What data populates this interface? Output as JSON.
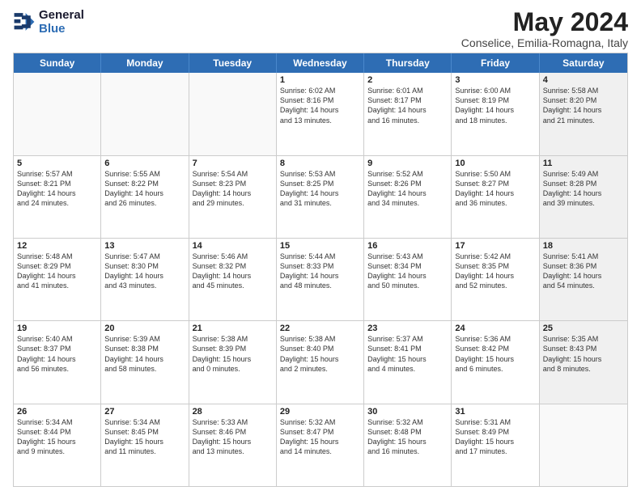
{
  "logo": {
    "line1": "General",
    "line2": "Blue"
  },
  "title": "May 2024",
  "subtitle": "Conselice, Emilia-Romagna, Italy",
  "calendar": {
    "headers": [
      "Sunday",
      "Monday",
      "Tuesday",
      "Wednesday",
      "Thursday",
      "Friday",
      "Saturday"
    ],
    "rows": [
      [
        {
          "day": "",
          "detail": "",
          "empty": true
        },
        {
          "day": "",
          "detail": "",
          "empty": true
        },
        {
          "day": "",
          "detail": "",
          "empty": true
        },
        {
          "day": "1",
          "detail": "Sunrise: 6:02 AM\nSunset: 8:16 PM\nDaylight: 14 hours\nand 13 minutes.",
          "empty": false
        },
        {
          "day": "2",
          "detail": "Sunrise: 6:01 AM\nSunset: 8:17 PM\nDaylight: 14 hours\nand 16 minutes.",
          "empty": false
        },
        {
          "day": "3",
          "detail": "Sunrise: 6:00 AM\nSunset: 8:19 PM\nDaylight: 14 hours\nand 18 minutes.",
          "empty": false
        },
        {
          "day": "4",
          "detail": "Sunrise: 5:58 AM\nSunset: 8:20 PM\nDaylight: 14 hours\nand 21 minutes.",
          "empty": false,
          "shaded": true
        }
      ],
      [
        {
          "day": "5",
          "detail": "Sunrise: 5:57 AM\nSunset: 8:21 PM\nDaylight: 14 hours\nand 24 minutes.",
          "empty": false
        },
        {
          "day": "6",
          "detail": "Sunrise: 5:55 AM\nSunset: 8:22 PM\nDaylight: 14 hours\nand 26 minutes.",
          "empty": false
        },
        {
          "day": "7",
          "detail": "Sunrise: 5:54 AM\nSunset: 8:23 PM\nDaylight: 14 hours\nand 29 minutes.",
          "empty": false
        },
        {
          "day": "8",
          "detail": "Sunrise: 5:53 AM\nSunset: 8:25 PM\nDaylight: 14 hours\nand 31 minutes.",
          "empty": false
        },
        {
          "day": "9",
          "detail": "Sunrise: 5:52 AM\nSunset: 8:26 PM\nDaylight: 14 hours\nand 34 minutes.",
          "empty": false
        },
        {
          "day": "10",
          "detail": "Sunrise: 5:50 AM\nSunset: 8:27 PM\nDaylight: 14 hours\nand 36 minutes.",
          "empty": false
        },
        {
          "day": "11",
          "detail": "Sunrise: 5:49 AM\nSunset: 8:28 PM\nDaylight: 14 hours\nand 39 minutes.",
          "empty": false,
          "shaded": true
        }
      ],
      [
        {
          "day": "12",
          "detail": "Sunrise: 5:48 AM\nSunset: 8:29 PM\nDaylight: 14 hours\nand 41 minutes.",
          "empty": false
        },
        {
          "day": "13",
          "detail": "Sunrise: 5:47 AM\nSunset: 8:30 PM\nDaylight: 14 hours\nand 43 minutes.",
          "empty": false
        },
        {
          "day": "14",
          "detail": "Sunrise: 5:46 AM\nSunset: 8:32 PM\nDaylight: 14 hours\nand 45 minutes.",
          "empty": false
        },
        {
          "day": "15",
          "detail": "Sunrise: 5:44 AM\nSunset: 8:33 PM\nDaylight: 14 hours\nand 48 minutes.",
          "empty": false
        },
        {
          "day": "16",
          "detail": "Sunrise: 5:43 AM\nSunset: 8:34 PM\nDaylight: 14 hours\nand 50 minutes.",
          "empty": false
        },
        {
          "day": "17",
          "detail": "Sunrise: 5:42 AM\nSunset: 8:35 PM\nDaylight: 14 hours\nand 52 minutes.",
          "empty": false
        },
        {
          "day": "18",
          "detail": "Sunrise: 5:41 AM\nSunset: 8:36 PM\nDaylight: 14 hours\nand 54 minutes.",
          "empty": false,
          "shaded": true
        }
      ],
      [
        {
          "day": "19",
          "detail": "Sunrise: 5:40 AM\nSunset: 8:37 PM\nDaylight: 14 hours\nand 56 minutes.",
          "empty": false
        },
        {
          "day": "20",
          "detail": "Sunrise: 5:39 AM\nSunset: 8:38 PM\nDaylight: 14 hours\nand 58 minutes.",
          "empty": false
        },
        {
          "day": "21",
          "detail": "Sunrise: 5:38 AM\nSunset: 8:39 PM\nDaylight: 15 hours\nand 0 minutes.",
          "empty": false
        },
        {
          "day": "22",
          "detail": "Sunrise: 5:38 AM\nSunset: 8:40 PM\nDaylight: 15 hours\nand 2 minutes.",
          "empty": false
        },
        {
          "day": "23",
          "detail": "Sunrise: 5:37 AM\nSunset: 8:41 PM\nDaylight: 15 hours\nand 4 minutes.",
          "empty": false
        },
        {
          "day": "24",
          "detail": "Sunrise: 5:36 AM\nSunset: 8:42 PM\nDaylight: 15 hours\nand 6 minutes.",
          "empty": false
        },
        {
          "day": "25",
          "detail": "Sunrise: 5:35 AM\nSunset: 8:43 PM\nDaylight: 15 hours\nand 8 minutes.",
          "empty": false,
          "shaded": true
        }
      ],
      [
        {
          "day": "26",
          "detail": "Sunrise: 5:34 AM\nSunset: 8:44 PM\nDaylight: 15 hours\nand 9 minutes.",
          "empty": false
        },
        {
          "day": "27",
          "detail": "Sunrise: 5:34 AM\nSunset: 8:45 PM\nDaylight: 15 hours\nand 11 minutes.",
          "empty": false
        },
        {
          "day": "28",
          "detail": "Sunrise: 5:33 AM\nSunset: 8:46 PM\nDaylight: 15 hours\nand 13 minutes.",
          "empty": false
        },
        {
          "day": "29",
          "detail": "Sunrise: 5:32 AM\nSunset: 8:47 PM\nDaylight: 15 hours\nand 14 minutes.",
          "empty": false
        },
        {
          "day": "30",
          "detail": "Sunrise: 5:32 AM\nSunset: 8:48 PM\nDaylight: 15 hours\nand 16 minutes.",
          "empty": false
        },
        {
          "day": "31",
          "detail": "Sunrise: 5:31 AM\nSunset: 8:49 PM\nDaylight: 15 hours\nand 17 minutes.",
          "empty": false
        },
        {
          "day": "",
          "detail": "",
          "empty": true,
          "shaded": true
        }
      ]
    ]
  }
}
